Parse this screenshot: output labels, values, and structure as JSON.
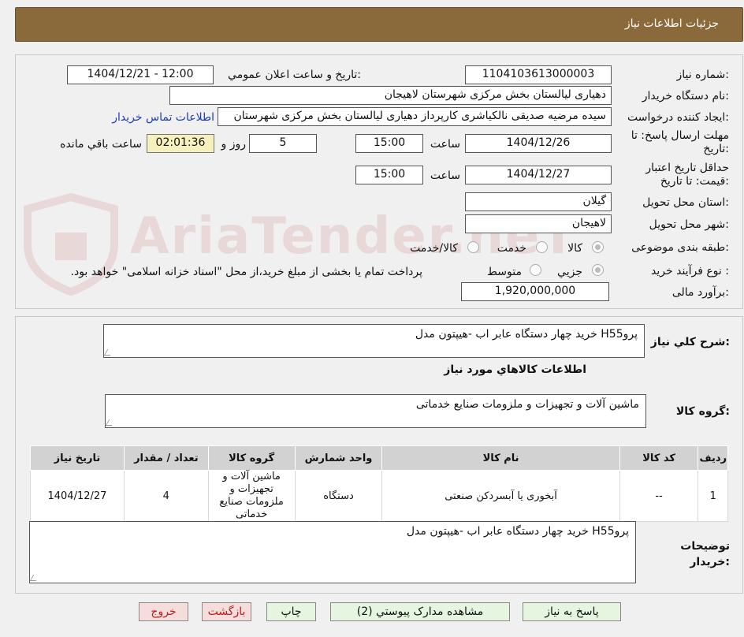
{
  "header": {
    "title": "جزئیات اطلاعات نیاز"
  },
  "form": {
    "need_number_label": "شماره نیاز:",
    "need_number": "1104103613000003",
    "announce_label": "تاریخ و ساعت اعلان عمومي:",
    "announce_value": "1404/12/21 - 12:00",
    "buyer_org_label": "نام دستگاه خریدار:",
    "buyer_org": "دهیاری لیالستان بخش مرکزی شهرستان لاهیجان",
    "requester_label": "ایجاد کننده درخواست:",
    "requester": "سیده مرضیه صدیقی نالکیاشری کارپرداز دهیاری لیالستان بخش مرکزی شهرستان",
    "contact_link": "اطلاعات تماس خریدار",
    "deadline_label": "مهلت ارسال پاسخ: تا تاریخ:",
    "deadline_date": "1404/12/26",
    "time_label": "ساعت",
    "deadline_time": "15:00",
    "days_value": "5",
    "days_label": "روز و",
    "remaining_time": "02:01:36",
    "remaining_label": "ساعت باقي مانده",
    "validity_label": "حداقل تاریخ اعتبار قیمت: تا تاریخ:",
    "validity_date": "1404/12/27",
    "validity_time": "15:00",
    "province_label": "استان محل تحویل:",
    "province": "گیلان",
    "city_label": "شهر محل تحویل:",
    "city": "لاهیجان",
    "category_label": "طبقه بندی موضوعی:",
    "category_options": [
      "کالا",
      "خدمت",
      "کالا/خدمت"
    ],
    "category_selected": "کالا",
    "process_label": "نوع فرآیند خرید :",
    "process_options": [
      "جزیي",
      "متوسط"
    ],
    "process_selected": "جزیي",
    "process_note": "پرداخت تمام یا بخشی از مبلغ خرید،از محل \"اسناد خزانه اسلامی\" خواهد بود.",
    "budget_label": "برآورد مالی:",
    "budget": "1,920,000,000"
  },
  "watermark": {
    "text": "AriaTender.neT"
  },
  "summary": {
    "label": "شرح کلي نیاز:",
    "text": "خرید چهار دستگاه عابر اب -هیپتون مدل H55پرو",
    "goods_info_title": "اطلاعات کالاهاي مورد نیاز",
    "goods_group_label": "گروه کالا:",
    "goods_group": "ماشین آلات و تجهیزات و ملزومات صنایع خدماتی"
  },
  "table": {
    "headers": [
      "ردیف",
      "کد کالا",
      "نام کالا",
      "واحد شمارش",
      "گروه کالا",
      "تعداد / مقدار",
      "تاریخ نیاز"
    ],
    "rows": [
      [
        "1",
        "--",
        "آبخوری یا آبسردکن صنعتی",
        "دستگاه",
        "ماشین آلات و تجهیزات و ملزومات صنایع خدماتی",
        "4",
        "1404/12/27"
      ]
    ]
  },
  "notes": {
    "label": "توضیحات خریدار:",
    "text": "خرید چهار دستگاه عابر اب -هیپتون مدل H55پرو"
  },
  "buttons": {
    "reply": "پاسخ به نیاز",
    "attachments": "مشاهده مدارک پیوستي (2)",
    "print": "چاپ",
    "back": "بازگشت",
    "exit": "خروج"
  }
}
